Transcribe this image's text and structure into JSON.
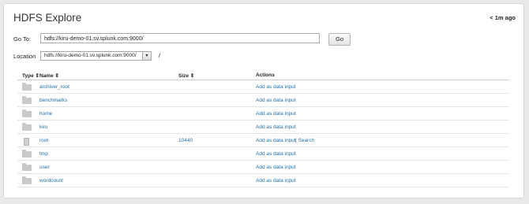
{
  "header": {
    "title": "HDFS Explore",
    "updated": "< 1m ago"
  },
  "goto": {
    "label": "Go To:",
    "value": "hdfs://kiru-demo-01.sv.splunk.com:9000/",
    "button": "Go"
  },
  "location": {
    "label": "Location",
    "selected": "hdfs://kiru-demo-01.sv.splunk.com:9000/",
    "path": "/"
  },
  "table": {
    "columns": {
      "type": "Type ⇕",
      "name": "Name ⇕",
      "size": "Size ⇕",
      "actions": "Actions"
    },
    "rows": [
      {
        "icon": "folder-icon",
        "name": "archiver_root",
        "size": "",
        "action": "Add as data input",
        "extra": ""
      },
      {
        "icon": "folder-icon",
        "name": "benchmarks",
        "size": "",
        "action": "Add as data input",
        "extra": ""
      },
      {
        "icon": "folder-icon",
        "name": "home",
        "size": "",
        "action": "Add as data input",
        "extra": ""
      },
      {
        "icon": "folder-icon",
        "name": "kiru",
        "size": "",
        "action": "Add as data input",
        "extra": ""
      },
      {
        "icon": "file-icon",
        "name": "root",
        "size": "10440",
        "action": "Add as data input",
        "extra": "| Search"
      },
      {
        "icon": "folder-icon",
        "name": "tmp",
        "size": "",
        "action": "Add as data input",
        "extra": ""
      },
      {
        "icon": "folder-icon",
        "name": "user",
        "size": "",
        "action": "Add as data input",
        "extra": ""
      },
      {
        "icon": "folder-icon",
        "name": "wordcount",
        "size": "",
        "action": "Add as data input",
        "extra": ""
      }
    ]
  }
}
